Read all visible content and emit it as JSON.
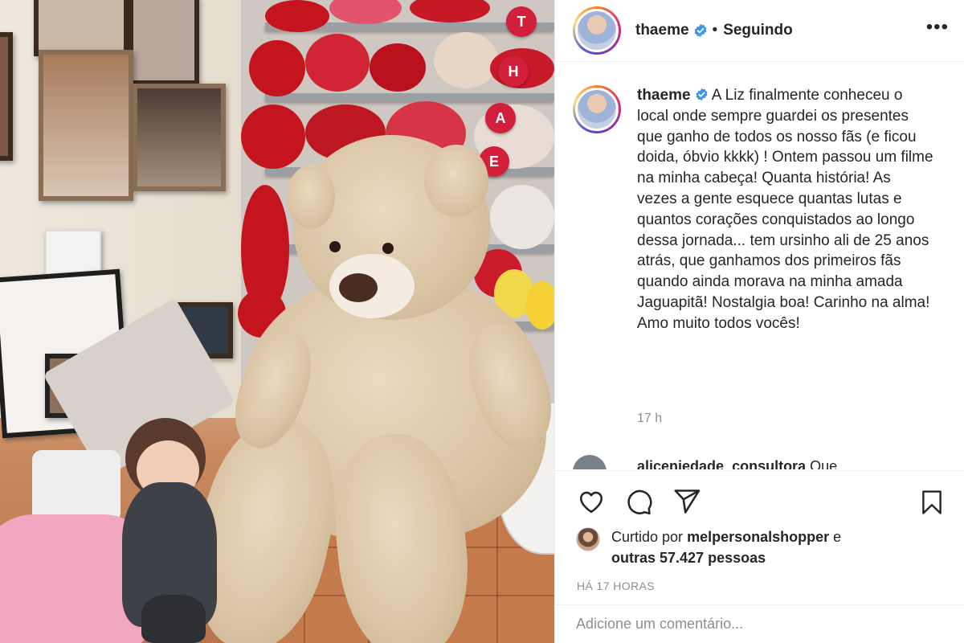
{
  "post": {
    "username": "thaeme",
    "follow_status": "Seguindo",
    "caption": "A Liz finalmente conheceu o local onde sempre guardei os presentes que ganho de todos os nosso fãs (e ficou doida, óbvio kkkk) ! Ontem passou um filme na minha cabeça! Quanta história! As vezes a gente esquece quantas lutas e quantos corações conquistados ao longo dessa jornada... tem ursinho ali de 25 anos atrás, que ganhamos dos primeiros fãs quando ainda morava na minha amada Jaguapitã! Nostalgia boa! Carinho na alma! Amo muito todos vocês!",
    "time_ago": "17 h",
    "next_comment_user": "aliceniedade_consultora",
    "next_comment_text": "Que",
    "liked_by_prefix": "Curtido por",
    "liked_by_user": "melpersonalshopper",
    "liked_by_suffix": "e",
    "likes_line": "outras 57.427 pessoas",
    "date": "HÁ 17 HORAS",
    "comment_placeholder": "Adicione um comentário..."
  },
  "photo": {
    "heart_letters": [
      "T",
      "H",
      "A",
      "E"
    ]
  },
  "icons": {
    "more": "more-options-icon",
    "like": "heart-icon",
    "comment": "comment-icon",
    "share": "share-icon",
    "save": "bookmark-icon",
    "verified": "verified-badge-icon"
  },
  "colors": {
    "verified": "#3897f0",
    "text": "#262626",
    "muted": "#8e8e8e",
    "heart_red": "#d21f3c"
  }
}
